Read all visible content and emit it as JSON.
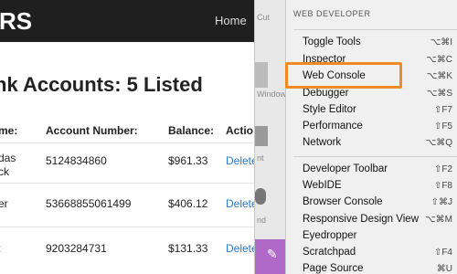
{
  "webpage": {
    "brand": "RS",
    "nav_home": "Home",
    "title": "nk Accounts: 5 Listed",
    "headers": [
      "me:",
      "Account Number:",
      "Balance:",
      "Actio"
    ],
    "rows": [
      {
        "name": "das\nck",
        "account": "5124834860",
        "balance": "$961.33",
        "action": "Delete"
      },
      {
        "name": "er",
        "account": "53668855061499",
        "balance": "$406.12",
        "action": "Delete"
      },
      {
        "name": ":",
        "account": "9203284731",
        "balance": "$131.33",
        "action": "Delete"
      }
    ]
  },
  "panel_strip": {
    "labels": [
      "Cut",
      "Window",
      "nt",
      "nd"
    ]
  },
  "menu": {
    "header": "WEB DEVELOPER",
    "group1": [
      {
        "label": "Toggle Tools",
        "shortcut": "⌥⌘I"
      },
      {
        "label": "Inspector",
        "shortcut": "⌥⌘C"
      },
      {
        "label": "Web Console",
        "shortcut": "⌥⌘K"
      },
      {
        "label": "Debugger",
        "shortcut": "⌥⌘S"
      },
      {
        "label": "Style Editor",
        "shortcut": "⇧F7"
      },
      {
        "label": "Performance",
        "shortcut": "⇧F5"
      },
      {
        "label": "Network",
        "shortcut": "⌥⌘Q"
      }
    ],
    "group2": [
      {
        "label": "Developer Toolbar",
        "shortcut": "⇧F2"
      },
      {
        "label": "WebIDE",
        "shortcut": "⇧F8"
      },
      {
        "label": "Browser Console",
        "shortcut": "⇧⌘J"
      },
      {
        "label": "Responsive Design View",
        "shortcut": "⌥⌘M"
      },
      {
        "label": "Eyedropper",
        "shortcut": ""
      },
      {
        "label": "Scratchpad",
        "shortcut": "⇧F4"
      },
      {
        "label": "Page Source",
        "shortcut": "⌘U"
      }
    ]
  },
  "highlight_color": "#f08a24"
}
